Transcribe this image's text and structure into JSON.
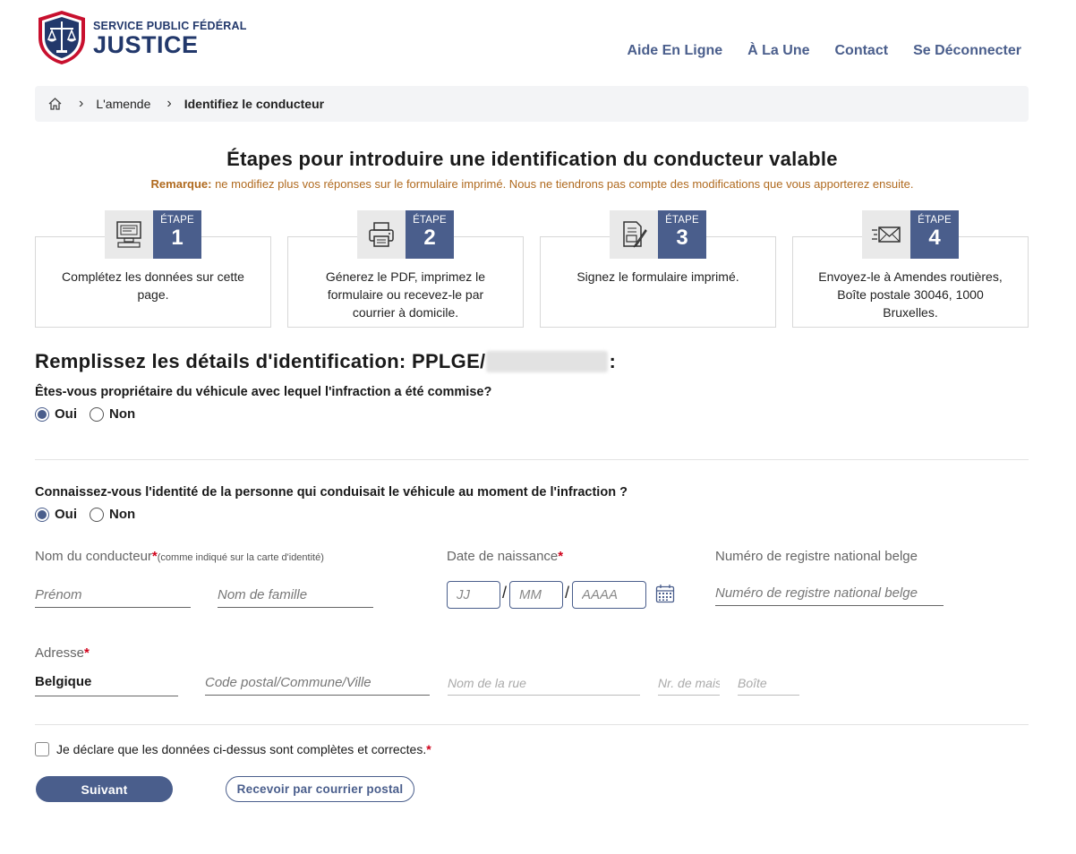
{
  "header": {
    "logo_line1": "SERVICE PUBLIC FÉDÉRAL",
    "logo_line2": "JUSTICE",
    "nav": [
      "Aide En Ligne",
      "À La Une",
      "Contact",
      "Se Déconnecter"
    ]
  },
  "breadcrumb": {
    "items": [
      "L'amende",
      "Identifiez le conducteur"
    ]
  },
  "steps": {
    "title": "Étapes pour introduire une identification du conducteur valable",
    "remark_label": "Remarque:",
    "remark_text": " ne modifiez plus vos réponses sur le formulaire imprimé. Nous ne tiendrons pas compte des modifications que vous apporterez ensuite.",
    "step_label": "ÉTAPE",
    "items": [
      {
        "num": "1",
        "icon": "computer-icon",
        "desc": "Complétez les données sur cette page."
      },
      {
        "num": "2",
        "icon": "printer-icon",
        "desc": "Génerez le PDF, imprimez le formulaire ou recevez-le par courrier à domicile."
      },
      {
        "num": "3",
        "icon": "sign-document-icon",
        "desc": "Signez le formulaire imprimé."
      },
      {
        "num": "4",
        "icon": "envelope-icon",
        "desc": "Envoyez-le à Amendes routières, Boîte postale 30046, 1000 Bruxelles."
      }
    ]
  },
  "form": {
    "title_prefix": "Remplissez les détails d'identification: PPLGE/",
    "title_suffix": ":",
    "q1": "Êtes-vous propriétaire du véhicule avec lequel l'infraction a été commise?",
    "q2": "Connaissez-vous l'identité de la personne qui conduisait le véhicule au moment de l'infraction ?",
    "yes": "Oui",
    "no": "Non",
    "driver_label": "Nom du conducteur",
    "driver_hint": "(comme indiqué sur la carte d'identité)",
    "required_mark": "*",
    "firstname_placeholder": "Prénom",
    "lastname_placeholder": "Nom de famille",
    "dob_label": "Date de naissance",
    "dd_placeholder": "JJ",
    "mm_placeholder": "MM",
    "yyyy_placeholder": "AAAA",
    "date_sep": "/",
    "nrn_label": "Numéro de registre national belge",
    "nrn_placeholder": "Numéro de registre national belge",
    "address_label": "Adresse",
    "country_value": "Belgique",
    "postal_placeholder": "Code postal/Commune/Ville",
    "street_placeholder": "Nom de la rue",
    "house_placeholder": "Nr. de maison",
    "box_placeholder": "Boîte",
    "declaration": "Je déclare que les données ci-dessus sont complètes et correctes.",
    "next_button": "Suivant",
    "postal_button": "Recevoir par courrier postal"
  },
  "colors": {
    "primary": "#4a5e8c",
    "brand_navy": "#22386b",
    "remark": "#b06a1f",
    "required": "#d0021b"
  }
}
